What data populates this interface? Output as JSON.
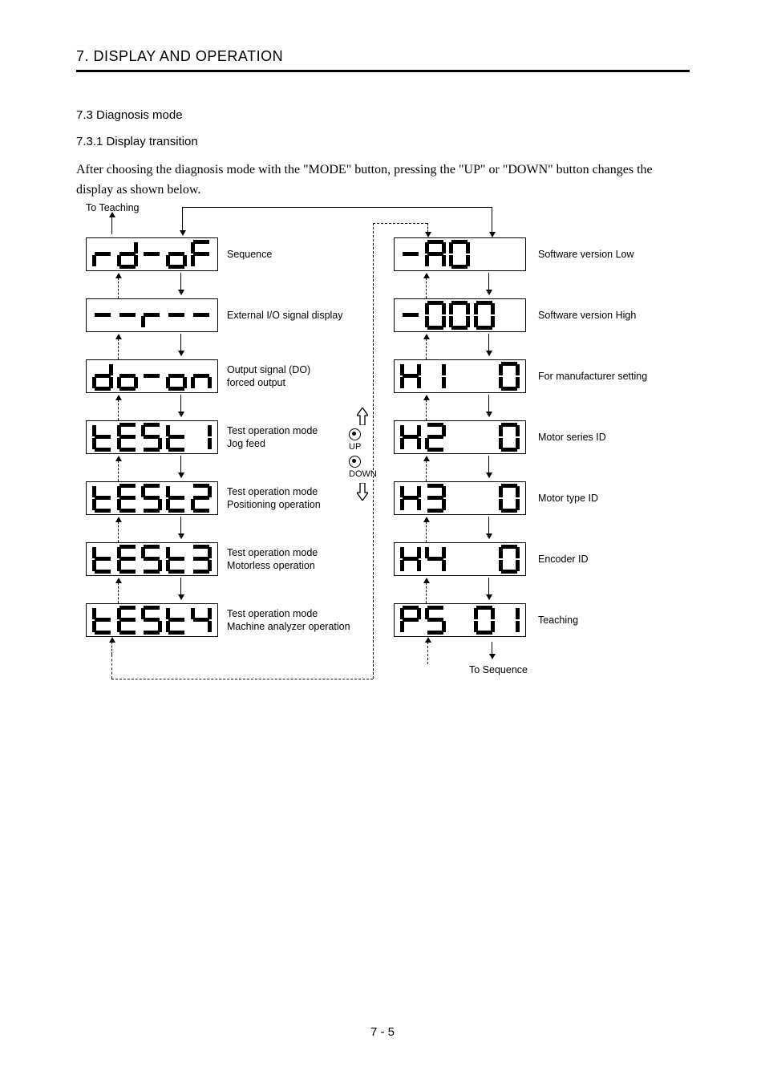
{
  "chapter_title": "7. DISPLAY AND OPERATION",
  "section": "7.3 Diagnosis mode",
  "subsection": "7.3.1 Display transition",
  "paragraph": "After choosing the diagnosis mode with the \"MODE\" button, pressing the \"UP\" or \"DOWN\" button changes the display as shown below.",
  "page_number": "7 -  5",
  "to_teaching": "To Teaching",
  "to_sequence": "To Sequence",
  "up_label": "UP",
  "down_label": "DOWN",
  "left_items": [
    {
      "label": "Sequence",
      "digits": [
        "r",
        "d",
        "-",
        "o",
        "F"
      ]
    },
    {
      "label": "External I/O signal display",
      "digits": [
        "-",
        "-",
        "r",
        "-",
        "-"
      ]
    },
    {
      "label": "Output signal (DO)\nforced output",
      "digits": [
        "d",
        "o",
        "-",
        "o",
        "n"
      ]
    },
    {
      "label": "Test operation mode\nJog feed",
      "digits": [
        "T",
        "E",
        "S",
        "T",
        "1"
      ]
    },
    {
      "label": "Test operation mode\nPositioning operation",
      "digits": [
        "T",
        "E",
        "S",
        "T",
        "2"
      ]
    },
    {
      "label": "Test operation mode\nMotorless operation",
      "digits": [
        "T",
        "E",
        "S",
        "T",
        "3"
      ]
    },
    {
      "label": "Test operation mode\nMachine analyzer operation",
      "digits": [
        "T",
        "E",
        "S",
        "T",
        "4"
      ]
    }
  ],
  "right_items": [
    {
      "label": "Software version Low",
      "digits": [
        "-",
        "A",
        "0",
        " ",
        " "
      ]
    },
    {
      "label": "Software version High",
      "digits": [
        "-",
        "0",
        "0",
        "0",
        " "
      ]
    },
    {
      "label": "For manufacturer setting",
      "digits": [
        "H",
        "1",
        " ",
        " ",
        "0"
      ]
    },
    {
      "label": "Motor series ID",
      "digits": [
        "H",
        "2",
        " ",
        " ",
        "0"
      ]
    },
    {
      "label": "Motor type ID",
      "digits": [
        "H",
        "3",
        " ",
        " ",
        "0"
      ]
    },
    {
      "label": "Encoder ID",
      "digits": [
        "H",
        "4",
        " ",
        " ",
        "0"
      ]
    },
    {
      "label": "Teaching",
      "digits": [
        "P",
        "S",
        " ",
        "0",
        "1"
      ]
    }
  ]
}
